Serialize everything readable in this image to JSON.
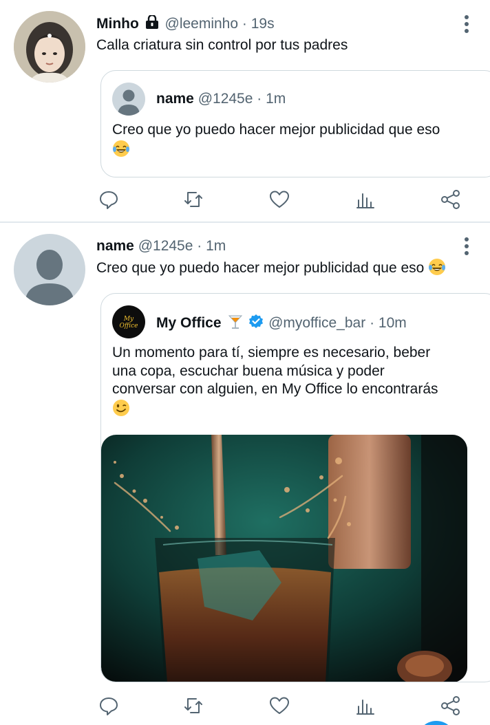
{
  "tweets": [
    {
      "name": "Minho",
      "handle": "@leeminho",
      "dot": "·",
      "time": "19s",
      "text": "Calla criatura sin control por tus padres",
      "quoted": {
        "name": "name",
        "handle": "@1245e",
        "dot": "·",
        "time": "1m",
        "text": "Creo que yo puedo hacer mejor publicidad que eso",
        "emoji": "laughing-tears-emoji"
      }
    },
    {
      "name": "name",
      "handle": "@1245e",
      "dot": "·",
      "time": "1m",
      "text": "Creo que yo puedo hacer mejor publicidad que eso",
      "emoji": "laughing-tears-emoji",
      "quoted": {
        "name": "My Office",
        "badge_icons": [
          "cocktail-emoji",
          "verified-badge-icon"
        ],
        "handle": "@myoffice_bar",
        "dot": "·",
        "time": "10m",
        "text_lines": [
          "Un momento para tí, siempre es necesario, beber",
          "una copa, escuchar buena música y poder",
          "conversar con alguien, en My Office lo encontrarás"
        ],
        "emoji": "winking-face-emoji",
        "avatar_logo_text": "My Office",
        "media": "photo-whisky-glass-splash"
      }
    }
  ],
  "icons": {
    "locked": "lock-icon",
    "more": "more-vertical-icon",
    "actions": [
      "reply-icon",
      "retweet-icon",
      "like-icon",
      "analytics-icon",
      "share-icon"
    ]
  },
  "colors": {
    "text": "#0f1419",
    "secondary": "#536471",
    "border": "#cfd9de",
    "verified": "#1d9bf0",
    "divider": "#e1e8ed"
  }
}
